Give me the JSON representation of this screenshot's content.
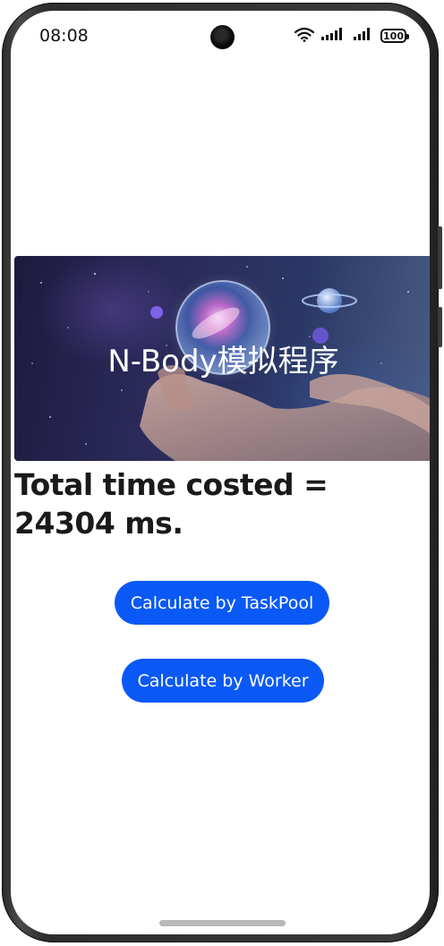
{
  "status_bar": {
    "time": "08:08",
    "battery": "100",
    "icons": [
      "wifi-icon",
      "signal-icon",
      "signal-icon",
      "battery-icon"
    ]
  },
  "banner": {
    "title": "N-Body模拟程序"
  },
  "result": {
    "text": "Total time costed = 24304 ms."
  },
  "buttons": {
    "taskpool_label": "Calculate by TaskPool",
    "worker_label": "Calculate by Worker"
  },
  "colors": {
    "accent": "#0a59f7",
    "text": "#1a1a1a",
    "background": "#ffffff"
  }
}
